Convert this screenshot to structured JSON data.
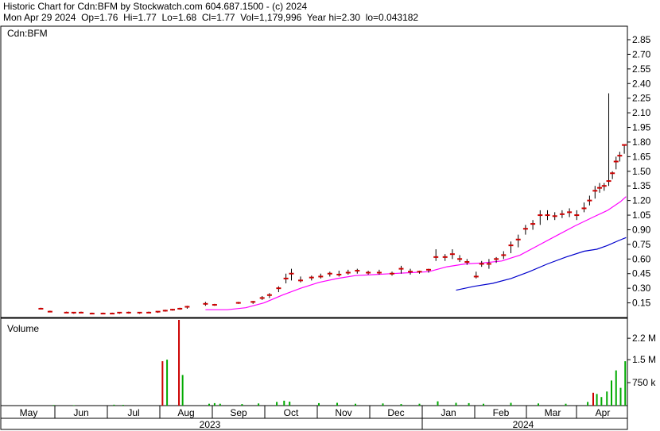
{
  "header": {
    "title_line": "Historic Chart for Cdn:BFM by Stockwatch.com 604.687.1500 - (c) 2024",
    "quote_line": "Mon Apr 29 2024  Op=1.76  Hi=1.77  Lo=1.68  Cl=1.77  Vol=1,179,996  Year hi=2.30  lo=0.043182"
  },
  "chart_data": {
    "type": "bar",
    "symbol": "Cdn:BFM",
    "volume_label": "Volume",
    "months": [
      "May",
      "Jun",
      "Jul",
      "Aug",
      "Sep",
      "Oct",
      "Nov",
      "Dec",
      "Jan",
      "Feb",
      "Mar",
      "Apr"
    ],
    "years": [
      "2023",
      "2024"
    ],
    "price_ticks": [
      "2.85",
      "2.70",
      "2.55",
      "2.40",
      "2.25",
      "2.10",
      "1.95",
      "1.80",
      "1.65",
      "1.50",
      "1.35",
      "1.20",
      "1.05",
      "0.90",
      "0.75",
      "0.60",
      "0.45",
      "0.30",
      "0.15"
    ],
    "volume_ticks": [
      "2.2 M",
      "1.5 M",
      "750 k"
    ],
    "price_ylim": [
      0,
      2.95
    ],
    "volume_ylim": [
      0,
      2800000
    ],
    "colors": {
      "price_bar": "#cc0000",
      "ma_short": "#ff00ff",
      "ma_long": "#0000cc",
      "vol_up": "#00aa00",
      "vol_down": "#cc0000"
    },
    "price": [
      {
        "t": 0.8,
        "hi": 0.1,
        "lo": 0.09,
        "cl": 0.09
      },
      {
        "t": 1.3,
        "hi": 0.07,
        "lo": 0.06,
        "cl": 0.06
      },
      {
        "t": 2.2,
        "hi": 0.06,
        "lo": 0.05,
        "cl": 0.05
      },
      {
        "t": 2.6,
        "hi": 0.05,
        "lo": 0.04,
        "cl": 0.05
      },
      {
        "t": 3.0,
        "hi": 0.06,
        "lo": 0.05,
        "cl": 0.05
      },
      {
        "t": 3.6,
        "hi": 0.05,
        "lo": 0.04,
        "cl": 0.04
      },
      {
        "t": 4.2,
        "hi": 0.05,
        "lo": 0.04,
        "cl": 0.04
      },
      {
        "t": 4.7,
        "hi": 0.05,
        "lo": 0.04,
        "cl": 0.04
      },
      {
        "t": 5.1,
        "hi": 0.05,
        "lo": 0.04,
        "cl": 0.05
      },
      {
        "t": 5.6,
        "hi": 0.06,
        "lo": 0.04,
        "cl": 0.05
      },
      {
        "t": 6.2,
        "hi": 0.05,
        "lo": 0.04,
        "cl": 0.05
      },
      {
        "t": 6.7,
        "hi": 0.06,
        "lo": 0.05,
        "cl": 0.05
      },
      {
        "t": 7.2,
        "hi": 0.06,
        "lo": 0.05,
        "cl": 0.06
      },
      {
        "t": 7.6,
        "hi": 0.08,
        "lo": 0.06,
        "cl": 0.07
      },
      {
        "t": 8.0,
        "hi": 0.09,
        "lo": 0.07,
        "cl": 0.08
      },
      {
        "t": 8.4,
        "hi": 0.1,
        "lo": 0.08,
        "cl": 0.09
      },
      {
        "t": 8.8,
        "hi": 0.12,
        "lo": 0.09,
        "cl": 0.11
      },
      {
        "t": 9.8,
        "hi": 0.16,
        "lo": 0.12,
        "cl": 0.14
      },
      {
        "t": 10.3,
        "hi": 0.14,
        "lo": 0.12,
        "cl": 0.13
      },
      {
        "t": 11.6,
        "hi": 0.16,
        "lo": 0.14,
        "cl": 0.15
      },
      {
        "t": 12.4,
        "hi": 0.17,
        "lo": 0.14,
        "cl": 0.16
      },
      {
        "t": 12.9,
        "hi": 0.22,
        "lo": 0.18,
        "cl": 0.2
      },
      {
        "t": 13.3,
        "hi": 0.25,
        "lo": 0.2,
        "cl": 0.23
      },
      {
        "t": 13.8,
        "hi": 0.32,
        "lo": 0.26,
        "cl": 0.3
      },
      {
        "t": 14.2,
        "hi": 0.45,
        "lo": 0.35,
        "cl": 0.4
      },
      {
        "t": 14.5,
        "hi": 0.5,
        "lo": 0.38,
        "cl": 0.45
      },
      {
        "t": 15.0,
        "hi": 0.42,
        "lo": 0.36,
        "cl": 0.38
      },
      {
        "t": 15.6,
        "hi": 0.43,
        "lo": 0.38,
        "cl": 0.41
      },
      {
        "t": 16.1,
        "hi": 0.45,
        "lo": 0.4,
        "cl": 0.42
      },
      {
        "t": 16.6,
        "hi": 0.47,
        "lo": 0.42,
        "cl": 0.45
      },
      {
        "t": 17.1,
        "hi": 0.48,
        "lo": 0.42,
        "cl": 0.44
      },
      {
        "t": 17.6,
        "hi": 0.49,
        "lo": 0.44,
        "cl": 0.46
      },
      {
        "t": 18.1,
        "hi": 0.5,
        "lo": 0.45,
        "cl": 0.48
      },
      {
        "t": 18.7,
        "hi": 0.48,
        "lo": 0.44,
        "cl": 0.46
      },
      {
        "t": 19.3,
        "hi": 0.49,
        "lo": 0.44,
        "cl": 0.46
      },
      {
        "t": 20.0,
        "hi": 0.47,
        "lo": 0.43,
        "cl": 0.45
      },
      {
        "t": 20.5,
        "hi": 0.53,
        "lo": 0.45,
        "cl": 0.5
      },
      {
        "t": 21.0,
        "hi": 0.5,
        "lo": 0.44,
        "cl": 0.47
      },
      {
        "t": 21.5,
        "hi": 0.48,
        "lo": 0.45,
        "cl": 0.47
      },
      {
        "t": 22.0,
        "hi": 0.5,
        "lo": 0.46,
        "cl": 0.49
      },
      {
        "t": 22.4,
        "hi": 0.7,
        "lo": 0.58,
        "cl": 0.62
      },
      {
        "t": 22.9,
        "hi": 0.65,
        "lo": 0.58,
        "cl": 0.62
      },
      {
        "t": 23.3,
        "hi": 0.7,
        "lo": 0.6,
        "cl": 0.65
      },
      {
        "t": 23.7,
        "hi": 0.64,
        "lo": 0.57,
        "cl": 0.6
      },
      {
        "t": 24.1,
        "hi": 0.6,
        "lo": 0.54,
        "cl": 0.57
      },
      {
        "t": 24.6,
        "hi": 0.47,
        "lo": 0.4,
        "cl": 0.42
      },
      {
        "t": 24.9,
        "hi": 0.58,
        "lo": 0.52,
        "cl": 0.55
      },
      {
        "t": 25.3,
        "hi": 0.6,
        "lo": 0.5,
        "cl": 0.55
      },
      {
        "t": 25.7,
        "hi": 0.62,
        "lo": 0.56,
        "cl": 0.6
      },
      {
        "t": 26.1,
        "hi": 0.68,
        "lo": 0.6,
        "cl": 0.64
      },
      {
        "t": 26.5,
        "hi": 0.78,
        "lo": 0.66,
        "cl": 0.74
      },
      {
        "t": 26.9,
        "hi": 0.85,
        "lo": 0.72,
        "cl": 0.8
      },
      {
        "t": 27.3,
        "hi": 0.95,
        "lo": 0.85,
        "cl": 0.91
      },
      {
        "t": 27.7,
        "hi": 1.0,
        "lo": 0.9,
        "cl": 0.96
      },
      {
        "t": 28.1,
        "hi": 1.1,
        "lo": 0.95,
        "cl": 1.05
      },
      {
        "t": 28.5,
        "hi": 1.1,
        "lo": 1.0,
        "cl": 1.05
      },
      {
        "t": 28.9,
        "hi": 1.08,
        "lo": 1.0,
        "cl": 1.04
      },
      {
        "t": 29.3,
        "hi": 1.1,
        "lo": 1.02,
        "cl": 1.06
      },
      {
        "t": 29.7,
        "hi": 1.12,
        "lo": 1.03,
        "cl": 1.08
      },
      {
        "t": 30.1,
        "hi": 1.1,
        "lo": 1.0,
        "cl": 1.05
      },
      {
        "t": 30.5,
        "hi": 1.18,
        "lo": 1.08,
        "cl": 1.12
      },
      {
        "t": 30.8,
        "hi": 1.25,
        "lo": 1.15,
        "cl": 1.2
      },
      {
        "t": 31.1,
        "hi": 1.35,
        "lo": 1.22,
        "cl": 1.3
      },
      {
        "t": 31.35,
        "hi": 1.38,
        "lo": 1.28,
        "cl": 1.33
      },
      {
        "t": 31.6,
        "hi": 1.38,
        "lo": 1.3,
        "cl": 1.35
      },
      {
        "t": 31.85,
        "hi": 2.3,
        "lo": 1.35,
        "cl": 1.4
      },
      {
        "t": 32.05,
        "hi": 1.5,
        "lo": 1.42,
        "cl": 1.48
      },
      {
        "t": 32.25,
        "hi": 1.65,
        "lo": 1.52,
        "cl": 1.6
      },
      {
        "t": 32.45,
        "hi": 1.7,
        "lo": 1.6,
        "cl": 1.66
      },
      {
        "t": 32.7,
        "hi": 1.77,
        "lo": 1.68,
        "cl": 1.77
      }
    ],
    "ma_short": [
      [
        9.8,
        0.08
      ],
      [
        11.0,
        0.08
      ],
      [
        12.0,
        0.1
      ],
      [
        13.0,
        0.15
      ],
      [
        14.0,
        0.23
      ],
      [
        15.0,
        0.3
      ],
      [
        16.0,
        0.36
      ],
      [
        17.0,
        0.4
      ],
      [
        18.0,
        0.43
      ],
      [
        19.0,
        0.44
      ],
      [
        20.0,
        0.45
      ],
      [
        21.0,
        0.46
      ],
      [
        22.0,
        0.47
      ],
      [
        23.0,
        0.52
      ],
      [
        24.0,
        0.55
      ],
      [
        25.0,
        0.56
      ],
      [
        26.0,
        0.58
      ],
      [
        27.0,
        0.64
      ],
      [
        28.0,
        0.74
      ],
      [
        29.0,
        0.84
      ],
      [
        30.0,
        0.94
      ],
      [
        31.0,
        1.03
      ],
      [
        31.8,
        1.1
      ],
      [
        32.5,
        1.19
      ],
      [
        32.8,
        1.24
      ]
    ],
    "ma_long": [
      [
        23.5,
        0.28
      ],
      [
        24.5,
        0.32
      ],
      [
        25.5,
        0.35
      ],
      [
        26.5,
        0.4
      ],
      [
        27.5,
        0.47
      ],
      [
        28.5,
        0.55
      ],
      [
        29.5,
        0.62
      ],
      [
        30.5,
        0.68
      ],
      [
        31.2,
        0.7
      ],
      [
        31.8,
        0.74
      ],
      [
        32.4,
        0.79
      ],
      [
        32.8,
        0.82
      ]
    ],
    "volume": [
      {
        "t": 1.5,
        "v": 20000,
        "up": true
      },
      {
        "t": 2.6,
        "v": 15000,
        "up": true
      },
      {
        "t": 4.8,
        "v": 30000,
        "up": true
      },
      {
        "t": 5.3,
        "v": 25000,
        "up": true
      },
      {
        "t": 7.45,
        "v": 1450000,
        "up": false
      },
      {
        "t": 7.7,
        "v": 1500000,
        "up": true
      },
      {
        "t": 8.35,
        "v": 2800000,
        "up": false
      },
      {
        "t": 8.55,
        "v": 1000000,
        "up": true
      },
      {
        "t": 10.0,
        "v": 60000,
        "up": true
      },
      {
        "t": 10.3,
        "v": 80000,
        "up": true
      },
      {
        "t": 10.6,
        "v": 60000,
        "up": true
      },
      {
        "t": 11.8,
        "v": 50000,
        "up": true
      },
      {
        "t": 12.7,
        "v": 70000,
        "up": true
      },
      {
        "t": 13.7,
        "v": 120000,
        "up": true
      },
      {
        "t": 14.1,
        "v": 160000,
        "up": true
      },
      {
        "t": 14.4,
        "v": 130000,
        "up": true
      },
      {
        "t": 16.0,
        "v": 80000,
        "up": true
      },
      {
        "t": 17.0,
        "v": 90000,
        "up": true
      },
      {
        "t": 18.0,
        "v": 60000,
        "up": true
      },
      {
        "t": 19.5,
        "v": 70000,
        "up": true
      },
      {
        "t": 20.5,
        "v": 50000,
        "up": true
      },
      {
        "t": 21.5,
        "v": 60000,
        "up": true
      },
      {
        "t": 22.5,
        "v": 140000,
        "up": true
      },
      {
        "t": 23.5,
        "v": 90000,
        "up": true
      },
      {
        "t": 24.2,
        "v": 80000,
        "up": true
      },
      {
        "t": 25.0,
        "v": 60000,
        "up": true
      },
      {
        "t": 26.5,
        "v": 90000,
        "up": true
      },
      {
        "t": 28.0,
        "v": 70000,
        "up": true
      },
      {
        "t": 29.5,
        "v": 60000,
        "up": true
      },
      {
        "t": 30.7,
        "v": 120000,
        "up": true
      },
      {
        "t": 31.0,
        "v": 420000,
        "up": false
      },
      {
        "t": 31.2,
        "v": 380000,
        "up": true
      },
      {
        "t": 31.45,
        "v": 280000,
        "up": true
      },
      {
        "t": 31.75,
        "v": 460000,
        "up": true
      },
      {
        "t": 32.0,
        "v": 820000,
        "up": true
      },
      {
        "t": 32.25,
        "v": 1150000,
        "up": true
      },
      {
        "t": 32.5,
        "v": 580000,
        "up": true
      },
      {
        "t": 32.75,
        "v": 1450000,
        "up": true
      }
    ]
  }
}
